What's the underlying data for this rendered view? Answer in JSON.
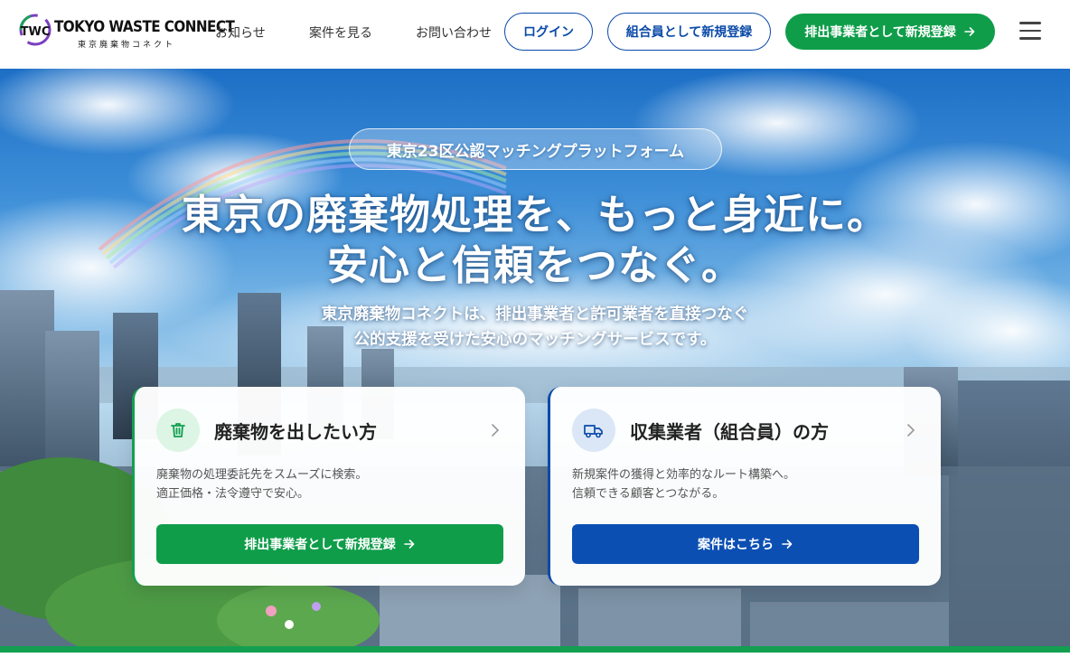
{
  "header": {
    "logo_mark": "TWC",
    "logo_en": "TOKYO WASTE CONNECT",
    "logo_jp": "東京廃棄物コネクト",
    "nav": [
      "お知らせ",
      "案件を見る",
      "お問い合わせ"
    ],
    "login_label": "ログイン",
    "member_register_label": "組合員として新規登録",
    "discharger_register_label": "排出事業者として新規登録",
    "menu_icon": "hamburger-icon"
  },
  "hero": {
    "badge": "東京23区公認マッチングプラットフォーム",
    "headline_line1": "東京の廃棄物処理を、もっと身近に。",
    "headline_line2": "安心と信頼をつなぐ。",
    "sub_line1": "東京廃棄物コネクトは、排出事業者と許可業者を直接つなぐ",
    "sub_line2": "公的支援を受けた安心のマッチングサービスです。"
  },
  "cards": [
    {
      "icon": "trash-icon",
      "title": "廃棄物を出したい方",
      "desc_line1": "廃棄物の処理委託先をスムーズに検索。",
      "desc_line2": "適正価格・法令遵守で安心。",
      "button": "排出事業者として新規登録",
      "accent": "#12a050"
    },
    {
      "icon": "truck-icon",
      "title": "収集業者（組合員）の方",
      "desc_line1": "新規案件の獲得と効率的なルート構築へ。",
      "desc_line2": "信頼できる顧客とつながる。",
      "button": "案件はこちら",
      "accent": "#0b4aa8"
    }
  ],
  "colors": {
    "green": "#0f9d4a",
    "blue": "#0b4aa8"
  }
}
